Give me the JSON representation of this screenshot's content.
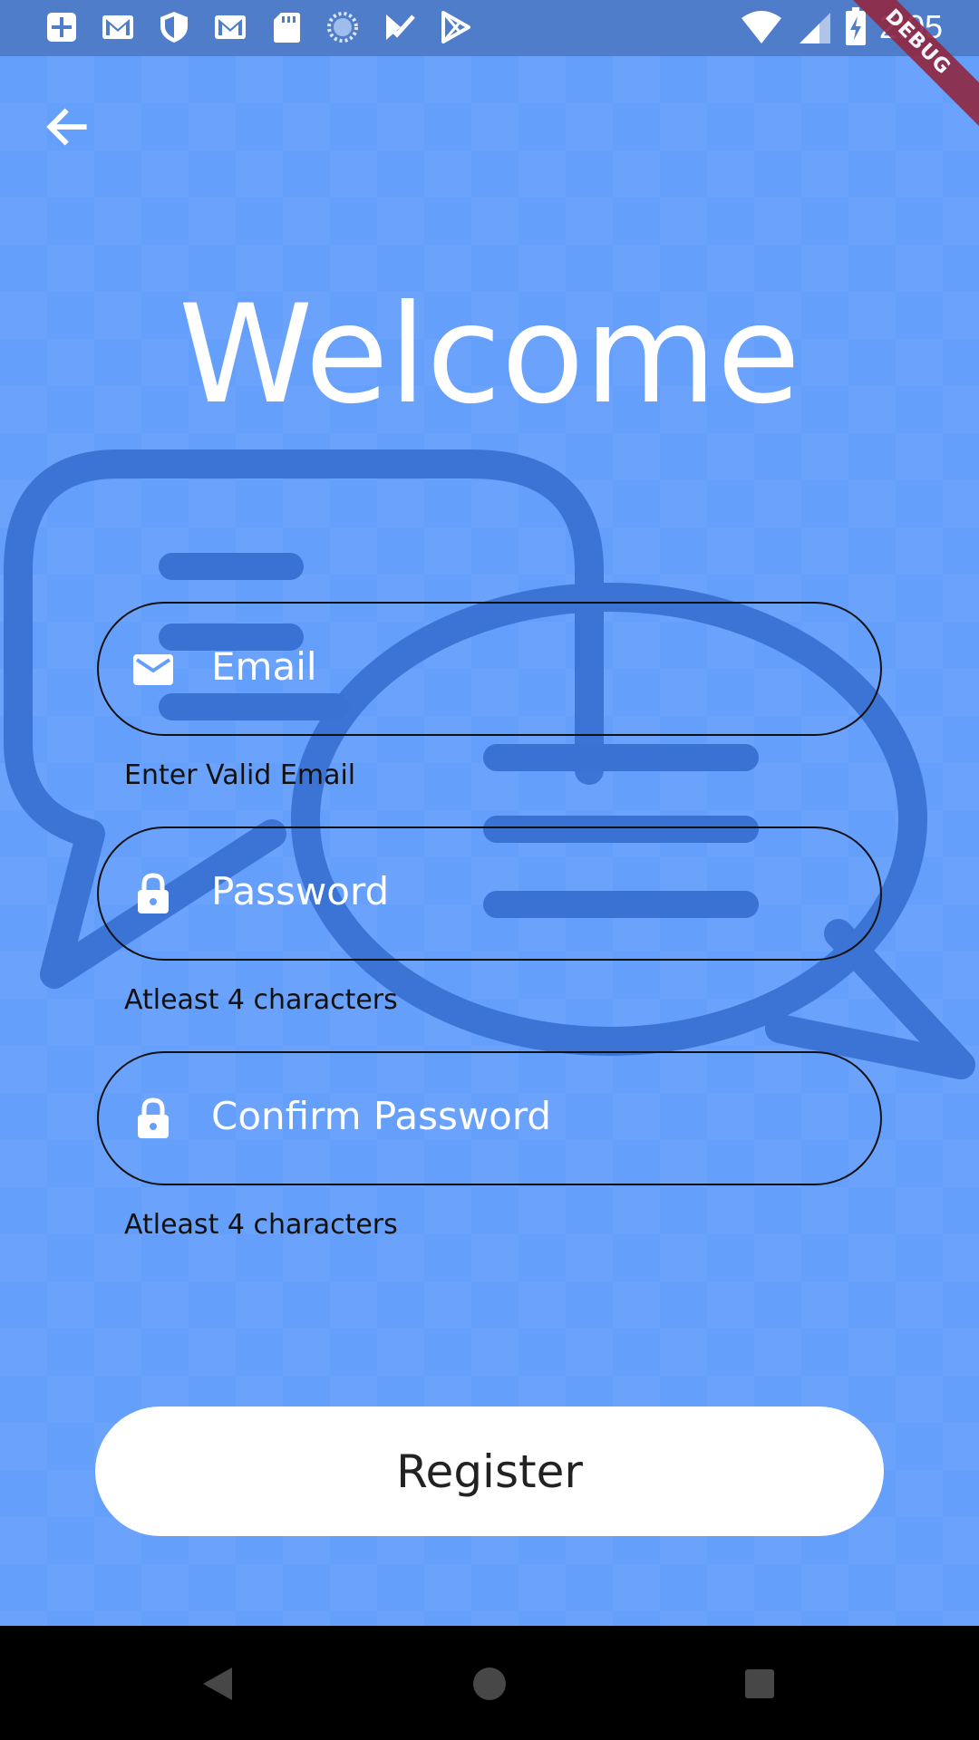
{
  "status_bar": {
    "time": "2:05",
    "left_icons": [
      "plus-box-icon",
      "gmail-icon",
      "shield-icon",
      "gmail-icon",
      "sd-card-icon",
      "sync-circle-icon",
      "todo-check-icon",
      "play-store-icon"
    ],
    "right_icons": [
      "wifi-icon",
      "signal-icon",
      "battery-charging-icon"
    ],
    "debug_label": "DEBUG",
    "color": "#4f7dc9"
  },
  "toolbar": {
    "back_icon": "arrow-back-icon"
  },
  "main": {
    "title": "Welcome",
    "fields": [
      {
        "icon": "email-icon",
        "placeholder": "Email",
        "helper": "Enter Valid Email"
      },
      {
        "icon": "lock-icon",
        "placeholder": "Password",
        "helper": "Atleast 4 characters"
      },
      {
        "icon": "lock-icon",
        "placeholder": "Confirm Password",
        "helper": "Atleast 4 characters"
      }
    ],
    "register_label": "Register"
  },
  "nav_bar": {
    "icons": [
      "back-triangle-icon",
      "home-circle-icon",
      "recents-square-icon"
    ]
  },
  "colors": {
    "background": "#659ffc",
    "illustration": "#3a72d3",
    "field_border": "#111111",
    "button": "#ffffff"
  }
}
